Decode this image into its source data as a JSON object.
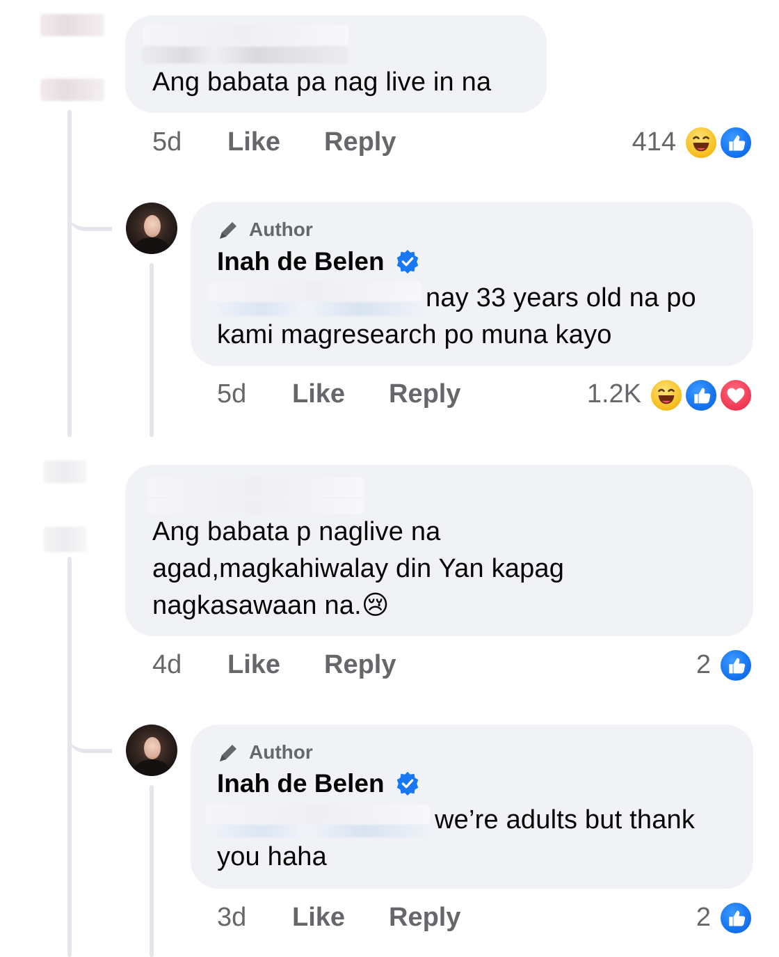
{
  "comments": [
    {
      "text": "Ang babata pa nag live in na",
      "time": "5d",
      "like_label": "Like",
      "reply_label": "Reply",
      "reaction_count": "414",
      "reactions": [
        "haha-icon",
        "like-icon"
      ],
      "reply": {
        "badge": "Author",
        "author": "Inah de Belen",
        "text_line1": "nay 33 years old na po",
        "text_line2": "kami magresearch po muna kayo",
        "time": "5d",
        "like_label": "Like",
        "reply_label": "Reply",
        "reaction_count": "1.2K",
        "reactions": [
          "haha-icon",
          "like-icon",
          "love-icon"
        ]
      }
    },
    {
      "text_line1": "Ang babata p naglive na",
      "text_line2": "agad,magkahiwalay din Yan kapag",
      "text_line3": "nagkasawaan na.",
      "emoji": "😢",
      "time": "4d",
      "like_label": "Like",
      "reply_label": "Reply",
      "reaction_count": "2",
      "reactions": [
        "like-icon"
      ],
      "reply": {
        "badge": "Author",
        "author": "Inah de Belen",
        "text_line1": "we’re adults but thank",
        "text_line2": "you haha",
        "time": "3d",
        "like_label": "Like",
        "reply_label": "Reply",
        "reaction_count": "2",
        "reactions": [
          "like-icon"
        ]
      }
    }
  ],
  "colors": {
    "bubble": "#f0f2f5",
    "meta_text": "#65676b",
    "like_blue": "#1877f2",
    "love_red": "#f33e58",
    "haha_yellow": "#f7c325",
    "thread_line": "#e4e6eb"
  }
}
